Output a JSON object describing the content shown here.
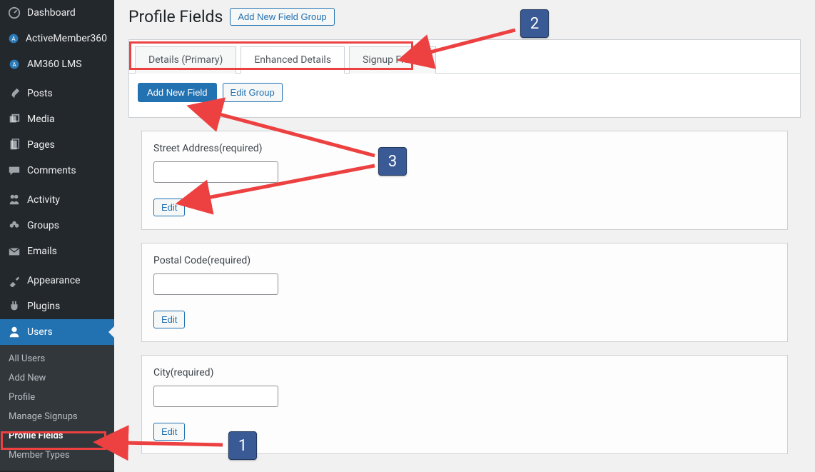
{
  "sidebar": {
    "items": [
      {
        "label": "Dashboard",
        "icon": "dashboard"
      },
      {
        "label": "ActiveMember360",
        "icon": "am360"
      },
      {
        "label": "AM360 LMS",
        "icon": "am360"
      },
      {
        "label": "Posts",
        "icon": "pin"
      },
      {
        "label": "Media",
        "icon": "media"
      },
      {
        "label": "Pages",
        "icon": "pages"
      },
      {
        "label": "Comments",
        "icon": "comment"
      },
      {
        "label": "Activity",
        "icon": "activity"
      },
      {
        "label": "Groups",
        "icon": "groups"
      },
      {
        "label": "Emails",
        "icon": "email"
      },
      {
        "label": "Appearance",
        "icon": "brush"
      },
      {
        "label": "Plugins",
        "icon": "plug"
      },
      {
        "label": "Users",
        "icon": "user"
      }
    ],
    "submenu": [
      "All Users",
      "Add New",
      "Profile",
      "Manage Signups",
      "Profile Fields",
      "Member Types"
    ],
    "current_submenu_index": 4
  },
  "page": {
    "title": "Profile Fields",
    "add_group_label": "Add New Field Group"
  },
  "tabs": [
    {
      "label": "Details (Primary)",
      "active": false
    },
    {
      "label": "Enhanced Details",
      "active": true
    },
    {
      "label": "Signup Fields",
      "active": false
    }
  ],
  "actions": {
    "add_field_label": "Add New Field",
    "edit_group_label": "Edit Group"
  },
  "fields": [
    {
      "name": "Street Address",
      "required_suffix": " (required)",
      "edit_label": "Edit"
    },
    {
      "name": "Postal Code",
      "required_suffix": " (required)",
      "edit_label": "Edit"
    },
    {
      "name": "City",
      "required_suffix": " (required)",
      "edit_label": "Edit"
    }
  ],
  "annotations": {
    "badges": {
      "one": "1",
      "two": "2",
      "three": "3"
    }
  }
}
